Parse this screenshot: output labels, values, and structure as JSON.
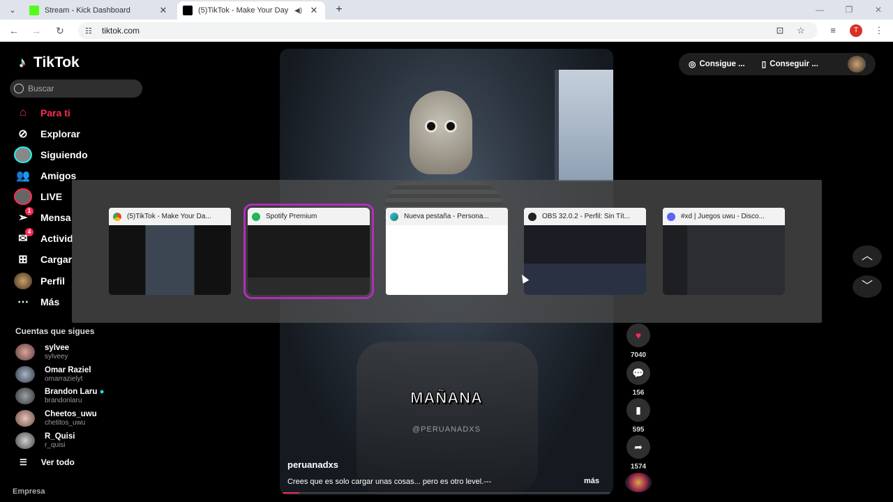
{
  "browser": {
    "tabs": [
      {
        "title": "Stream - Kick Dashboard",
        "favicon": "kick-icon"
      },
      {
        "title": "(5)TikTok - Make Your Day",
        "favicon": "tiktok-icon"
      }
    ],
    "url": "tiktok.com",
    "profile_initial": "T"
  },
  "tiktok": {
    "logo": "TikTok",
    "search_placeholder": "Buscar",
    "nav": [
      {
        "label": "Para ti"
      },
      {
        "label": "Explorar"
      },
      {
        "label": "Siguiendo"
      },
      {
        "label": "Amigos"
      },
      {
        "label": "LIVE"
      },
      {
        "label": "Mensa",
        "badge": "1"
      },
      {
        "label": "Activid",
        "badge": "4"
      },
      {
        "label": "Cargar"
      },
      {
        "label": "Perfil"
      },
      {
        "label": "Más"
      }
    ],
    "following_title": "Cuentas que sigues",
    "following": [
      {
        "name": "sylvee",
        "handle": "sylveey"
      },
      {
        "name": "Omar Raziel",
        "handle": "omarrazielyt"
      },
      {
        "name": "Brandon Laru",
        "handle": "brandonlaru"
      },
      {
        "name": "Cheetos_uwu",
        "handle": "chetitos_uwu"
      },
      {
        "name": "R_Quisi",
        "handle": "r_quisi"
      }
    ],
    "see_all": "Ver todo",
    "footer": "Empresa",
    "top_actions": [
      {
        "label": "Consigue ..."
      },
      {
        "label": "Conseguir ..."
      }
    ],
    "video": {
      "overlay_text": "MAÑANA",
      "watermark": "@PERUANADXS",
      "author": "peruanadxs",
      "description": "Crees que es solo cargar unas cosas... pero es otro level.---",
      "more": "más",
      "progress": 0.05
    },
    "actions": [
      {
        "icon": "heart-icon",
        "count": "7040"
      },
      {
        "icon": "comment-icon",
        "count": "156"
      },
      {
        "icon": "bookmark-icon",
        "count": "595"
      },
      {
        "icon": "share-icon",
        "count": "1574"
      }
    ]
  },
  "switcher": {
    "windows": [
      {
        "title": "(5)TikTok - Make Your Da...",
        "icon": "chrome-icon"
      },
      {
        "title": "Spotify Premium",
        "icon": "spotify-icon"
      },
      {
        "title": "Nueva pestaña - Persona...",
        "icon": "edge-icon"
      },
      {
        "title": "OBS 32.0.2 - Perfil: Sin Tít...",
        "icon": "obs-icon"
      },
      {
        "title": "#xd | Juegos uwu - Disco...",
        "icon": "discord-icon"
      }
    ],
    "selected": 1
  },
  "colors": {
    "accent": "#fe2c55",
    "switcher_selected": "#b02fb8"
  }
}
